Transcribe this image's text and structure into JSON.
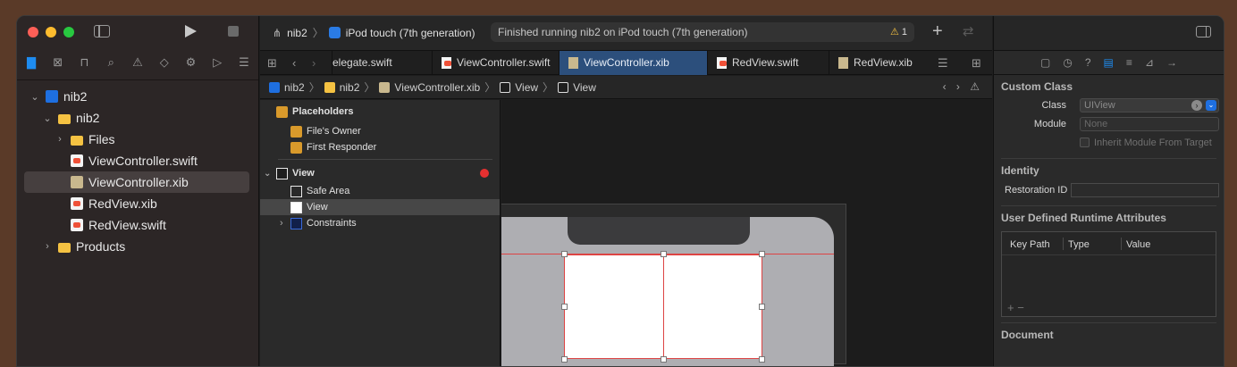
{
  "navigator": {
    "tabs": [
      {
        "icon": "folder-icon",
        "glyph": "▇"
      },
      {
        "icon": "source-control-icon",
        "glyph": "⊠"
      },
      {
        "icon": "symbol-icon",
        "glyph": "⊓"
      },
      {
        "icon": "find-icon",
        "glyph": "⌕"
      },
      {
        "icon": "issue-icon",
        "glyph": "⚠"
      },
      {
        "icon": "test-icon",
        "glyph": "◇"
      },
      {
        "icon": "debug-icon",
        "glyph": "⚙"
      },
      {
        "icon": "breakpoint-icon",
        "glyph": "▷"
      },
      {
        "icon": "report-icon",
        "glyph": "☰"
      }
    ],
    "tree": [
      {
        "label": "nib2",
        "kind": "project",
        "chevron": "⌄",
        "indent": 14
      },
      {
        "label": "nib2",
        "kind": "folder",
        "chevron": "⌄",
        "indent": 28
      },
      {
        "label": "Files",
        "kind": "folder",
        "chevron": "›",
        "indent": 42
      },
      {
        "label": "ViewController.swift",
        "kind": "swift",
        "chevron": "",
        "indent": 42
      },
      {
        "label": "ViewController.xib",
        "kind": "xib",
        "chevron": "",
        "indent": 42,
        "selected": true
      },
      {
        "label": "RedView.xib",
        "kind": "swift",
        "chevron": "",
        "indent": 42
      },
      {
        "label": "RedView.swift",
        "kind": "swift",
        "chevron": "",
        "indent": 42
      },
      {
        "label": "Products",
        "kind": "folder",
        "chevron": "›",
        "indent": 28
      }
    ]
  },
  "toolbar": {
    "scheme": "nib2",
    "scheme_sep": "〉",
    "device": "iPod touch (7th generation)",
    "status": "Finished running nib2 on iPod touch (7th generation)",
    "warning_count": "1",
    "plus": "+",
    "swap": "⇄"
  },
  "tabs": [
    {
      "label": "elegate.swift",
      "type": "swift"
    },
    {
      "label": "ViewController.swift",
      "type": "swift"
    },
    {
      "label": "ViewController.xib",
      "type": "xib",
      "active": true
    },
    {
      "label": "RedView.swift",
      "type": "swift"
    },
    {
      "label": "RedView.xib",
      "type": "xib"
    }
  ],
  "jumpbar": {
    "items": [
      "nib2",
      "nib2",
      "ViewController.xib",
      "View",
      "View"
    ],
    "right": "‹ › ⚠"
  },
  "outline": {
    "placeholders_title": "Placeholders",
    "placeholders": [
      "File's Owner",
      "First Responder"
    ],
    "view_title": "View",
    "children": [
      "Safe Area",
      "View",
      "Constraints"
    ]
  },
  "inspector": {
    "tabs": [
      "▢",
      "◷",
      "?",
      "▤",
      "≡",
      "⊿",
      "→"
    ],
    "custom_class": {
      "title": "Custom Class",
      "class_label": "Class",
      "class_placeholder": "UIView",
      "module_label": "Module",
      "module_value": "None",
      "inherit_label": "Inherit Module From Target"
    },
    "identity": {
      "title": "Identity",
      "restoration_label": "Restoration ID"
    },
    "runtime": {
      "title": "User Defined Runtime Attributes",
      "col_key": "Key Path",
      "col_type": "Type",
      "col_value": "Value",
      "footer": "+  −"
    },
    "document": {
      "title": "Document"
    }
  },
  "colors": {
    "accent": "#1e8cf0",
    "active_tab": "#2c4f7c",
    "constraint_red": "#dd4444",
    "error": "#e53030"
  }
}
